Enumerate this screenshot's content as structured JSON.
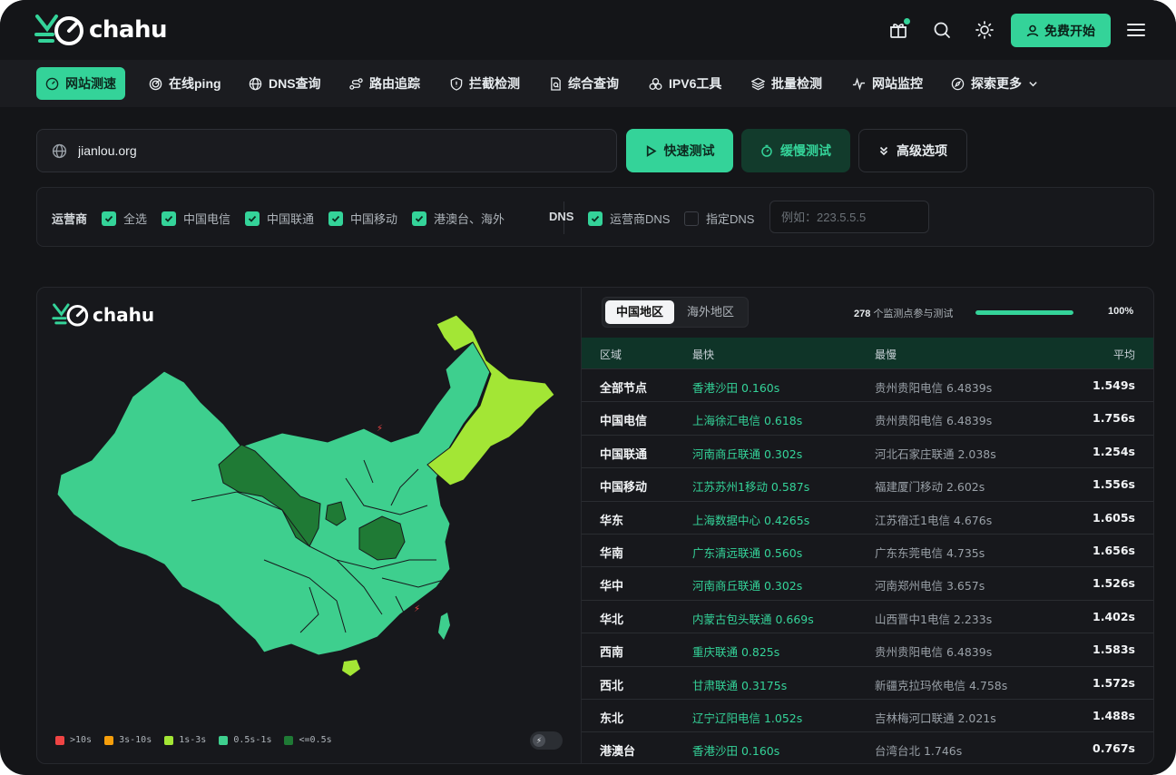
{
  "brand": {
    "name": "chahu",
    "accent": "#34d399"
  },
  "header": {
    "start_label": "免费开始"
  },
  "nav": {
    "items": [
      {
        "label": "网站测速",
        "icon": "gauge-icon"
      },
      {
        "label": "在线ping",
        "icon": "radar-icon"
      },
      {
        "label": "DNS查询",
        "icon": "globe-icon"
      },
      {
        "label": "路由追踪",
        "icon": "route-icon"
      },
      {
        "label": "拦截检测",
        "icon": "shield-icon"
      },
      {
        "label": "综合查询",
        "icon": "document-search-icon"
      },
      {
        "label": "IPV6工具",
        "icon": "network-icon"
      },
      {
        "label": "批量检测",
        "icon": "layers-icon"
      },
      {
        "label": "网站监控",
        "icon": "pulse-icon"
      },
      {
        "label": "探索更多",
        "icon": "compass-icon"
      }
    ]
  },
  "search": {
    "value": "jianlou.org",
    "quick_label": "快速测试",
    "slow_label": "缓慢测试",
    "advanced_label": "高级选项"
  },
  "filters": {
    "isp_label": "运营商",
    "isp_options": [
      {
        "label": "全选",
        "checked": true
      },
      {
        "label": "中国电信",
        "checked": true
      },
      {
        "label": "中国联通",
        "checked": true
      },
      {
        "label": "中国移动",
        "checked": true
      },
      {
        "label": "港澳台、海外",
        "checked": true
      }
    ],
    "dns_label": "DNS",
    "dns_options": [
      {
        "label": "运营商DNS",
        "checked": true
      },
      {
        "label": "指定DNS",
        "checked": false
      }
    ],
    "dns_placeholder": "例如：223.5.5.5"
  },
  "results": {
    "tabs": [
      "中国地区",
      "海外地区"
    ],
    "active_tab": "中国地区",
    "node_count": "278",
    "node_text": "个监测点参与测试",
    "progress_percent": 100,
    "progress_label": "100%",
    "columns": [
      "区域",
      "最快",
      "最慢",
      "平均"
    ],
    "rows": [
      {
        "region": "全部节点",
        "fastest": "香港沙田 0.160s",
        "slowest": "贵州贵阳电信 6.4839s",
        "avg": "1.549s"
      },
      {
        "region": "中国电信",
        "fastest": "上海徐汇电信 0.618s",
        "slowest": "贵州贵阳电信 6.4839s",
        "avg": "1.756s"
      },
      {
        "region": "中国联通",
        "fastest": "河南商丘联通 0.302s",
        "slowest": "河北石家庄联通 2.038s",
        "avg": "1.254s"
      },
      {
        "region": "中国移动",
        "fastest": "江苏苏州1移动 0.587s",
        "slowest": "福建厦门移动 2.602s",
        "avg": "1.556s"
      },
      {
        "region": "华东",
        "fastest": "上海数据中心 0.4265s",
        "slowest": "江苏宿迁1电信 4.676s",
        "avg": "1.605s"
      },
      {
        "region": "华南",
        "fastest": "广东清远联通 0.560s",
        "slowest": "广东东莞电信 4.735s",
        "avg": "1.656s"
      },
      {
        "region": "华中",
        "fastest": "河南商丘联通 0.302s",
        "slowest": "河南郑州电信 3.657s",
        "avg": "1.526s"
      },
      {
        "region": "华北",
        "fastest": "内蒙古包头联通 0.669s",
        "slowest": "山西晋中1电信 2.233s",
        "avg": "1.402s"
      },
      {
        "region": "西南",
        "fastest": "重庆联通 0.825s",
        "slowest": "贵州贵阳电信 6.4839s",
        "avg": "1.583s"
      },
      {
        "region": "西北",
        "fastest": "甘肃联通 0.3175s",
        "slowest": "新疆克拉玛依电信 4.758s",
        "avg": "1.572s"
      },
      {
        "region": "东北",
        "fastest": "辽宁辽阳电信 1.052s",
        "slowest": "吉林梅河口联通 2.021s",
        "avg": "1.488s"
      },
      {
        "region": "港澳台",
        "fastest": "香港沙田 0.160s",
        "slowest": "台湾台北 1.746s",
        "avg": "0.767s"
      }
    ]
  },
  "map": {
    "legend": [
      {
        "label": ">10s",
        "color": "#ef4444"
      },
      {
        "label": "3s-10s",
        "color": "#f59e0b"
      },
      {
        "label": "1s-3s",
        "color": "#a3e635"
      },
      {
        "label": "0.5s-1s",
        "color": "#3ecf8e"
      },
      {
        "label": "<=0.5s",
        "color": "#1f7a35"
      }
    ]
  }
}
